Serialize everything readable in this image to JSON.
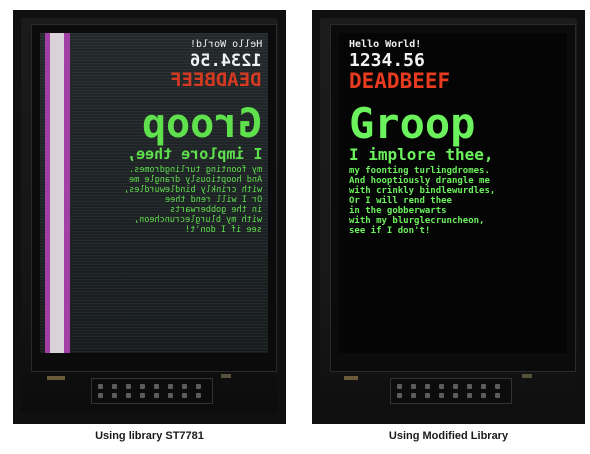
{
  "captions": {
    "left": "Using library ST7781",
    "right": "Using Modified Library"
  },
  "display": {
    "hello": "Hello World!",
    "number": "1234.56",
    "hex": "DEADBEEF",
    "title": "Groop",
    "poem_line1": "I implore thee,",
    "poem": [
      "my foonting turlingdromes.",
      "And hooptiously drangle me",
      "with crinkly bindlewurdles,",
      "Or I will rend thee",
      "in the gobberwarts",
      "with my blurglecruncheon,",
      "see if I don't!"
    ]
  },
  "colors": {
    "text_white": "#f2f2f2",
    "hex_red": "#e83a1f",
    "poem_green": "#6bf25c",
    "left_stripe_white": "#d9d2d6",
    "left_stripe_magenta": "#a13fa6"
  }
}
